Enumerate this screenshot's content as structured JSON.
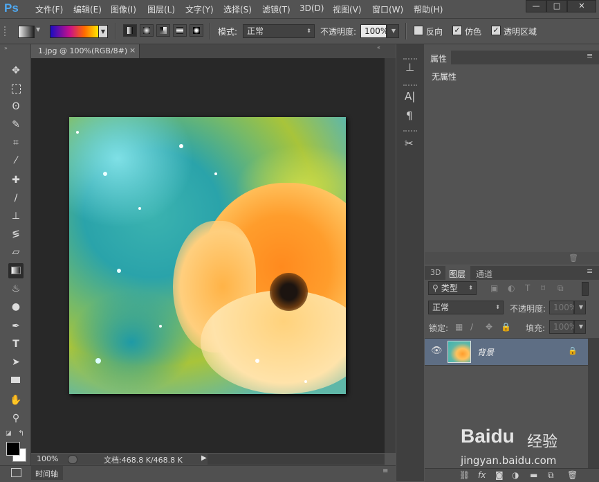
{
  "app": {
    "logo": "Ps"
  },
  "menu": [
    "文件(F)",
    "编辑(E)",
    "图像(I)",
    "图层(L)",
    "文字(Y)",
    "选择(S)",
    "滤镜(T)",
    "3D(D)",
    "视图(V)",
    "窗口(W)",
    "帮助(H)"
  ],
  "window_controls": {
    "minimize": "—",
    "maximize": "□",
    "close": "✕"
  },
  "options": {
    "mode_label": "模式:",
    "mode_value": "正常",
    "opacity_label": "不透明度:",
    "opacity_value": "100%",
    "reverse_label": "反向",
    "dither_label": "仿色",
    "transparency_label": "透明区域",
    "reverse_checked": false,
    "dither_checked": true,
    "transparency_checked": true
  },
  "document": {
    "tab_title": "1.jpg @ 100%(RGB/8#)",
    "tab_close": "×",
    "zoom": "100%",
    "doc_info": "文档:468.8 K/468.8 K",
    "timeline_label": "时间轴"
  },
  "properties": {
    "tab": "属性",
    "content": "无属性"
  },
  "layers": {
    "tabs": [
      "3D",
      "图层",
      "通道"
    ],
    "filter_label": "类型",
    "blend_mode": "正常",
    "opacity_label": "不透明度:",
    "opacity_value": "100%",
    "lock_label": "锁定:",
    "fill_label": "填充:",
    "fill_value": "100%",
    "layer_name": "背景"
  },
  "watermark": {
    "brand": "Baidu",
    "sub": "经验",
    "url": "jingyan.baidu.com"
  },
  "colors": {
    "accent_blue": "#4fa8f0",
    "layer_selected": "#5e6e84",
    "canvas_bg": "#282828"
  }
}
